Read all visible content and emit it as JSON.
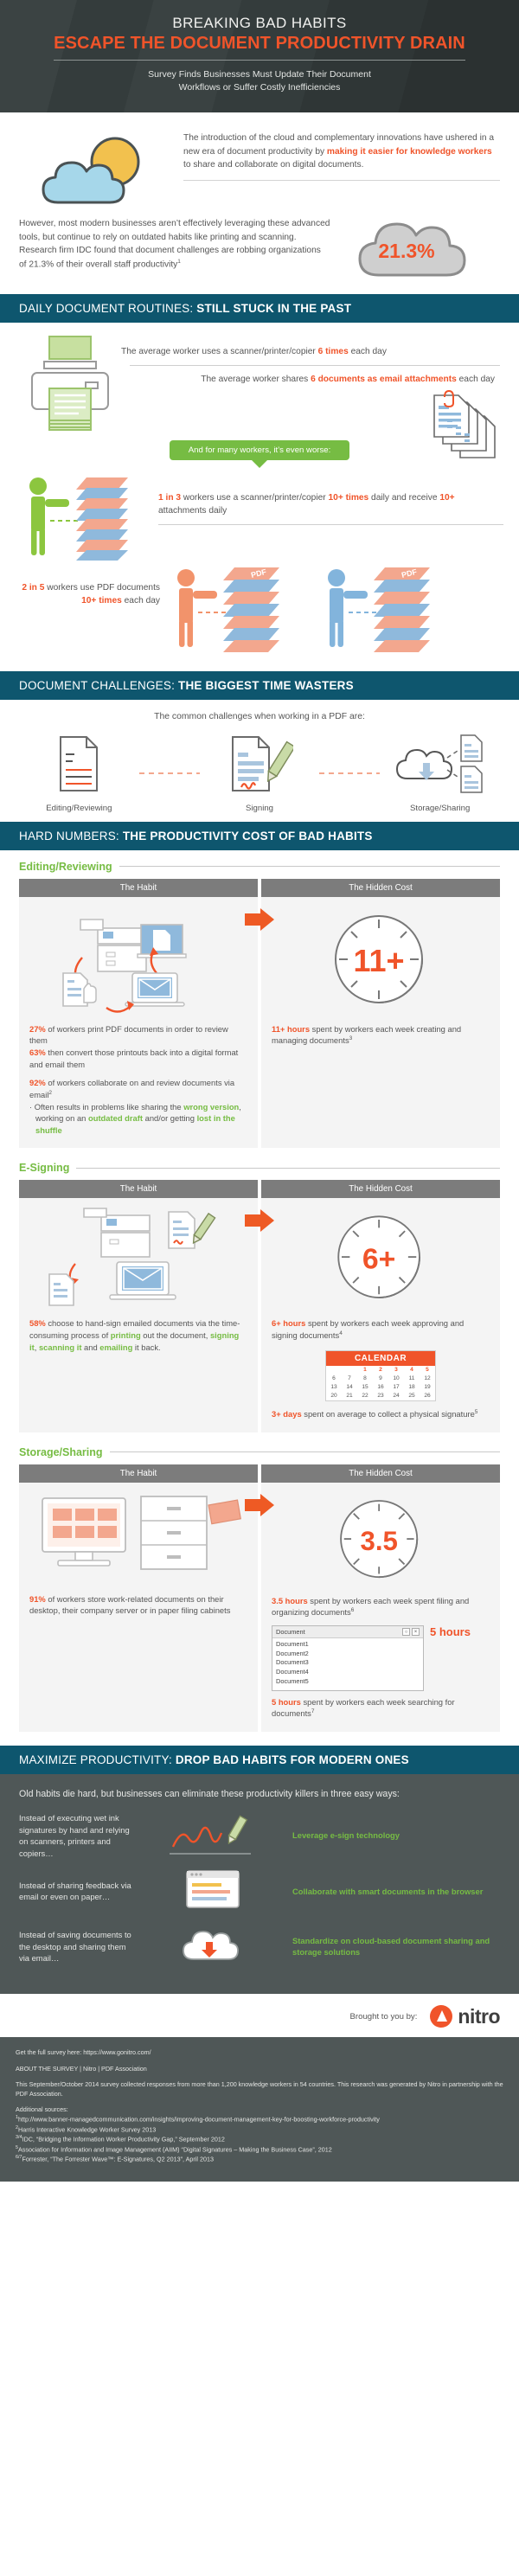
{
  "header": {
    "title": "BREAKING BAD HABITS",
    "subtitle": "ESCAPE THE DOCUMENT PRODUCTIVITY DRAIN",
    "tagline_line1": "Survey Finds Businesses Must Update Their Document",
    "tagline_line2": "Workflows or Suffer Costly Inefficiencies"
  },
  "intro": {
    "paragraph1_a": "The introduction of the cloud and complementary innovations have ushered in a new era of document productivity by ",
    "paragraph1_hl": "making it easier for knowledge workers",
    "paragraph1_b": " to share and collaborate on digital documents.",
    "paragraph2_a": "However, most modern businesses aren’t effectively leveraging these advanced tools, but continue to rely on outdated habits like printing and scanning. Research firm IDC found that ",
    "paragraph2_hl": "document challenges are robbing organizations of 21.3% of their overall staff productivity",
    "paragraph2_sup": "1",
    "cloud_stat": "21.3%"
  },
  "section_daily": {
    "bar_normal": "DAILY DOCUMENT ROUTINES: ",
    "bar_bold": "STILL STUCK IN THE PAST",
    "stat1_a": "The average worker uses a scanner/printer/copier ",
    "stat1_hl": "6 times",
    "stat1_b": " each day",
    "stat2_a": "The average worker shares ",
    "stat2_hl": "6 documents as email attachments",
    "stat2_b": " each day",
    "banner": "And for many workers, it’s even worse:",
    "stat3_hl1": "1 in 3",
    "stat3_a": " workers use a scanner/printer/copier ",
    "stat3_hl2": "10+ times",
    "stat3_b": " daily and receive ",
    "stat3_hl3": "10+",
    "stat3_c": " attachments daily",
    "stat4_hl1": "2 in 5",
    "stat4_a": " workers use PDF documents ",
    "stat4_hl2": "10+ times",
    "stat4_b": " each day"
  },
  "section_challenges": {
    "bar_normal": "DOCUMENT CHALLENGES: ",
    "bar_bold": "THE BIGGEST TIME WASTERS",
    "lead": "The common challenges when working in a PDF are:",
    "items": [
      {
        "label": "Editing/Reviewing",
        "icon": "document-edit-icon"
      },
      {
        "label": "Signing",
        "icon": "document-sign-pen-icon"
      },
      {
        "label": "Storage/Sharing",
        "icon": "cloud-storage-icon"
      }
    ]
  },
  "section_hard_numbers": {
    "bar_normal": "HARD NUMBERS: ",
    "bar_bold": "THE PRODUCTIVITY COST OF BAD HABITS",
    "col_head_habit": "The Habit",
    "col_head_cost": "The Hidden Cost",
    "blocks": [
      {
        "title": "Editing/Reviewing",
        "habit": {
          "stat1_hl": "27%",
          "stat1_text": " of workers print PDF documents in order to review them",
          "stat2_hl": "63%",
          "stat2_text": " then convert those printouts back into a digital format and email them",
          "stat3_hl": "92%",
          "stat3_text": " of workers collaborate on and review documents via email",
          "stat3_sup": "2",
          "bullet_a": "· Often results in problems like sharing the ",
          "bullet_g1": "wrong version",
          "bullet_b": ", working on an ",
          "bullet_g2": "outdated draft",
          "bullet_c": " and/or getting ",
          "bullet_g3": "lost in the shuffle"
        },
        "cost": {
          "clock_value": "11+",
          "stat_hl": "11+ hours",
          "stat_text": " spent by workers each week creating and managing documents",
          "stat_sup": "3"
        }
      },
      {
        "title": "E-Signing",
        "habit": {
          "stat1_hl": "58%",
          "stat1_a": " choose to hand-sign emailed documents via the time-consuming process of ",
          "stat1_g1": "printing",
          "stat1_b": " out the document, ",
          "stat1_g2": "signing it",
          "stat1_c": ", ",
          "stat1_g3": "scanning it",
          "stat1_d": " and ",
          "stat1_g4": "emailing",
          "stat1_e": " it back."
        },
        "cost": {
          "clock_value": "6+",
          "stat_hl": "6+ hours",
          "stat_text": " spent by workers each week approving and signing documents",
          "stat_sup": "4",
          "calendar_title": "CALENDAR",
          "calendar_rows": [
            [
              "",
              "1",
              "2",
              "3",
              "4",
              "5"
            ],
            [
              "6",
              "7",
              "8",
              "9",
              "10",
              "11",
              "12"
            ],
            [
              "13",
              "14",
              "15",
              "16",
              "17",
              "18",
              "19"
            ],
            [
              "20",
              "21",
              "22",
              "23",
              "24",
              "25",
              "26"
            ]
          ],
          "stat2_hl": "3+ days",
          "stat2_text": " spent on average to collect a physical signature",
          "stat2_sup": "5"
        }
      },
      {
        "title": "Storage/Sharing",
        "habit": {
          "stat1_hl": "91%",
          "stat1_text": " of workers store work-related documents on their desktop, their company server or in paper filing cabinets"
        },
        "cost": {
          "clock_value": "3.5",
          "stat_hl": "3.5 hours",
          "stat_text": " spent by workers each week spent filing and organizing documents",
          "stat_sup": "6",
          "window_title": "Document",
          "window_files": [
            "Document1",
            "Document2",
            "Document3",
            "Document4",
            "Document5"
          ],
          "badge": "5 hours",
          "stat2_hl": "5 hours",
          "stat2_text": " spent by workers each week searching for documents",
          "stat2_sup": "7"
        }
      }
    ]
  },
  "section_maximize": {
    "bar_normal": "MAXIMIZE PRODUCTIVITY: ",
    "bar_bold": "DROP BAD HABITS FOR MODERN ONES",
    "lead": "Old habits die hard, but businesses can eliminate these productivity killers in three easy ways:",
    "rows": [
      {
        "habit": "Instead of executing wet ink signatures by hand and relying on scanners, printers and copiers…",
        "solution": "Leverage e-sign technology",
        "icon": "esign-signature-icon"
      },
      {
        "habit": "Instead of sharing feedback via email or even on paper…",
        "solution": "Collaborate with smart documents in the browser",
        "icon": "browser-collaborate-icon"
      },
      {
        "habit": "Instead of saving documents to the desktop and sharing them via email…",
        "solution": "Standardize on cloud-based document sharing and storage solutions",
        "icon": "cloud-sharing-icon"
      }
    ]
  },
  "brand": {
    "brought_by": "Brought to you by:",
    "logo_word": "nitro"
  },
  "footer": {
    "survey_link_label": "Get the full survey here: https://www.gonitro.com/",
    "about_label": "ABOUT THE SURVEY | Nitro | PDF Association",
    "survey_desc": "This September/October 2014 survey collected responses from more than 1,200 knowledge workers in 54 countries. This research was generated by Nitro in partnership with the PDF Association.",
    "sources_label": "Additional sources:",
    "sources": [
      {
        "sup": "1",
        "text": "http://www.banner-managedcommunication.com/insights/improving-document-management-key-for-boosting-workforce-productivity"
      },
      {
        "sup": "2",
        "text": "Harris Interactive Knowledge Worker Survey 2013"
      },
      {
        "sup": "3/4",
        "text": "IDC, “Bridging the Information Worker Productivity Gap,” September 2012"
      },
      {
        "sup": "5",
        "text": "Association for Information and Image Management (AIIM) “Digital Signatures – Making the Business Case”, 2012"
      },
      {
        "sup": "6/7",
        "text": "Forrester, “The Forrester Wave™: E-Signatures, Q2 2013”, April 2013"
      }
    ]
  },
  "colors": {
    "orange": "#f0542a",
    "green": "#76bc43",
    "teal": "#0e566e",
    "dark": "#343c3c",
    "slate": "#4f5757",
    "blue": "#8fb9dc",
    "yellow": "#f2c14e"
  }
}
